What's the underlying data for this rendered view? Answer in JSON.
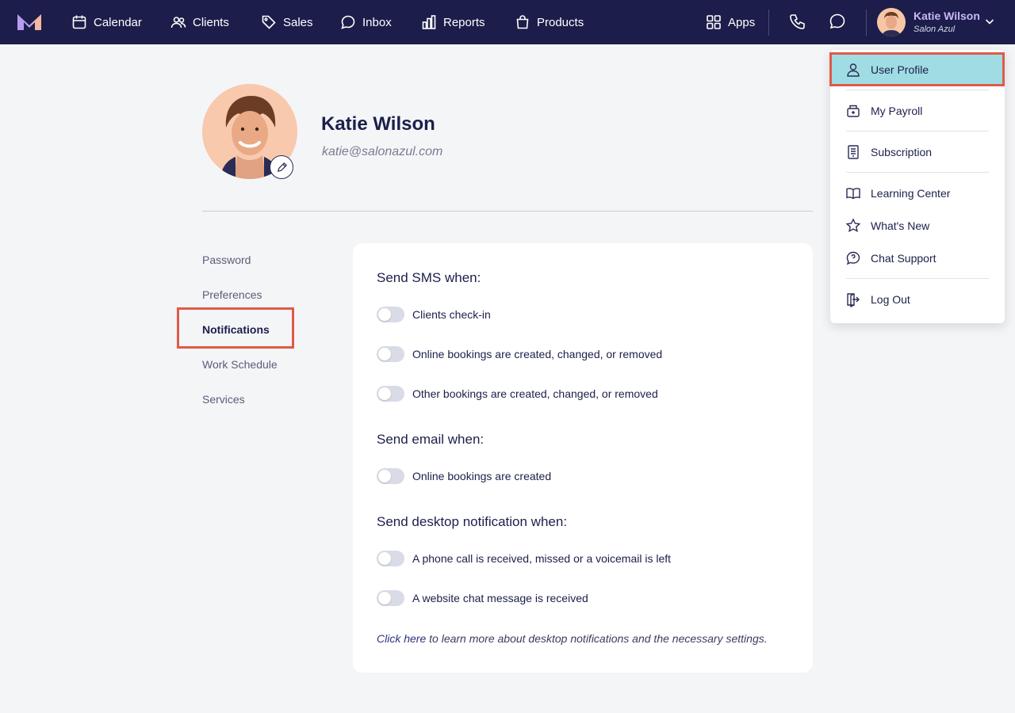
{
  "nav": {
    "items": [
      {
        "label": "Calendar",
        "icon": "calendar-icon"
      },
      {
        "label": "Clients",
        "icon": "clients-icon"
      },
      {
        "label": "Sales",
        "icon": "tag-icon"
      },
      {
        "label": "Inbox",
        "icon": "chat-bubble-icon"
      },
      {
        "label": "Reports",
        "icon": "bar-chart-icon"
      },
      {
        "label": "Products",
        "icon": "shopping-bag-icon"
      }
    ],
    "apps_label": "Apps",
    "user_name": "Katie Wilson",
    "user_org": "Salon Azul"
  },
  "profile": {
    "name": "Katie Wilson",
    "email": "katie@salonazul.com"
  },
  "side_nav": {
    "items": [
      "Password",
      "Preferences",
      "Notifications",
      "Work Schedule",
      "Services"
    ],
    "active": "Notifications"
  },
  "notifications": {
    "sms_title": "Send SMS when:",
    "sms_items": [
      "Clients check-in",
      "Online bookings are created, changed, or removed",
      "Other bookings are created, changed, or removed"
    ],
    "email_title": "Send email when:",
    "email_items": [
      "Online bookings are created"
    ],
    "desktop_title": "Send desktop notification when:",
    "desktop_items": [
      "A phone call is received, missed or a voicemail is left",
      "A website chat message is received"
    ],
    "footnote_link": "Click here",
    "footnote_rest": " to learn more about desktop notifications and the necessary settings."
  },
  "dropdown": {
    "items": [
      "User Profile",
      "My Payroll",
      "Subscription",
      "Learning Center",
      "What's New",
      "Chat Support",
      "Log Out"
    ],
    "active": "User Profile"
  },
  "colors": {
    "topbar": "#1c1d4a",
    "highlight": "#e05a48",
    "active_menu": "#9fdde3"
  }
}
